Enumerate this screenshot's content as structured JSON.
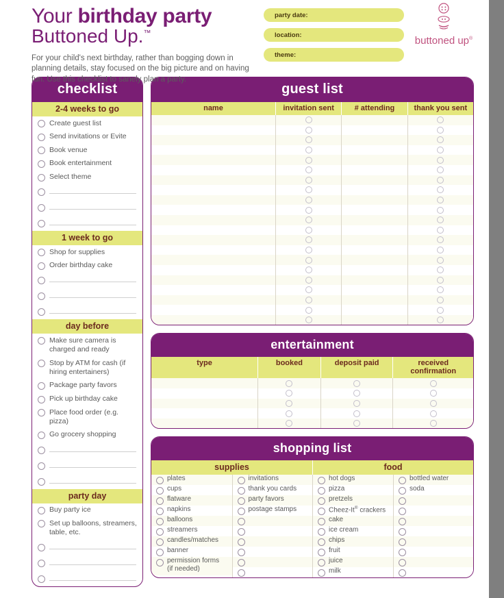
{
  "header": {
    "title_prefix": "Your ",
    "title_main": "birthday party",
    "title_line2": "Buttoned Up.",
    "trademark": "™",
    "intro": "For your child's next birthday, rather than bogging down in planning details, stay focused on the big picture and on having fun. Use this checklist to sanely plan a party.",
    "logo_text": "buttoned up",
    "logo_reg": "®"
  },
  "form_fields": [
    {
      "label": "party date:",
      "value": ""
    },
    {
      "label": "location:",
      "value": ""
    },
    {
      "label": "theme:",
      "value": ""
    }
  ],
  "checklist": {
    "title": "checklist",
    "sections": [
      {
        "band": "2-4 weeks to go",
        "items": [
          "Create guest list",
          "Send invitations or Evite",
          "Book venue",
          "Book entertainment",
          "Select theme"
        ],
        "blanks": 3
      },
      {
        "band": "1 week to go",
        "items": [
          "Shop for supplies",
          "Order birthday cake"
        ],
        "blanks": 3
      },
      {
        "band": "day before",
        "items": [
          "Make sure camera is charged and ready",
          "Stop by ATM for cash (if hiring entertainers)",
          "Package party favors",
          "Pick up birthday cake",
          "Place food order (e.g. pizza)",
          "Go grocery shopping"
        ],
        "blanks": 3
      },
      {
        "band": "party day",
        "items": [
          "Buy party ice",
          "Set up balloons, streamers, table, etc."
        ],
        "blanks": 3
      }
    ]
  },
  "guest_list": {
    "title": "guest list",
    "columns": [
      "name",
      "invitation sent",
      "# attending",
      "thank you sent"
    ],
    "row_count": 21,
    "circle_columns": [
      1,
      3
    ]
  },
  "entertainment": {
    "title": "entertainment",
    "columns": [
      "type",
      "booked",
      "deposit paid",
      "received confirmation"
    ],
    "row_count": 5,
    "circle_columns": [
      1,
      2,
      3
    ]
  },
  "shopping_list": {
    "title": "shopping list",
    "groups": [
      {
        "label": "supplies",
        "columns": [
          [
            "plates",
            "cups",
            "flatware",
            "napkins",
            "balloons",
            "streamers",
            "candles/matches",
            "banner",
            "permission forms (if needed)"
          ],
          [
            "invitations",
            "thank you cards",
            "party favors",
            "postage stamps",
            "",
            "",
            "",
            "",
            "",
            ""
          ]
        ]
      },
      {
        "label": "food",
        "columns": [
          [
            "hot dogs",
            "pizza",
            "pretzels",
            "Cheez-It® crackers",
            "cake",
            "ice cream",
            "chips",
            "fruit",
            "juice",
            "milk"
          ],
          [
            "bottled water",
            "soda",
            "",
            "",
            "",
            "",
            "",
            "",
            "",
            ""
          ]
        ]
      }
    ]
  },
  "colors": {
    "purple": "#7a1e74",
    "yellow": "#e4e77d",
    "band_text": "#6b2a1e",
    "pink": "#c0527f",
    "body_text": "#595959",
    "row_stripe": "#fbfbf0"
  }
}
